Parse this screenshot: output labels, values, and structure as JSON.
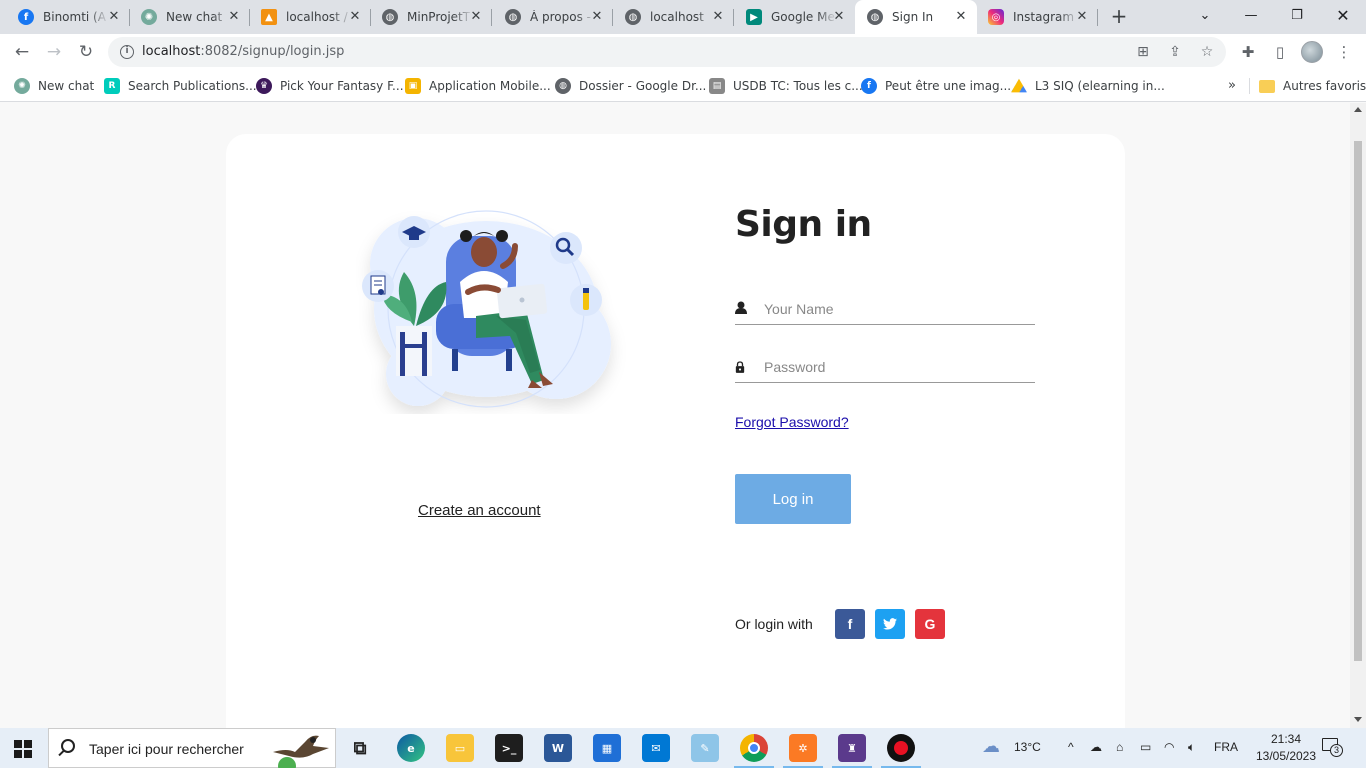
{
  "browser": {
    "tabs": [
      {
        "title": "Binomti (A",
        "favicon": "facebook-icon",
        "color": "#1877f2",
        "active": false
      },
      {
        "title": "New chat",
        "favicon": "chatgpt-icon",
        "color": "#74aa9c",
        "active": false
      },
      {
        "title": "localhost /",
        "favicon": "phpmyadmin-icon",
        "color": "#f29111",
        "active": false
      },
      {
        "title": "MinProjetT",
        "favicon": "globe-icon",
        "color": "#5f6368",
        "active": false
      },
      {
        "title": "À propos -",
        "favicon": "globe-icon",
        "color": "#5f6368",
        "active": false
      },
      {
        "title": "localhost",
        "favicon": "globe-icon",
        "color": "#5f6368",
        "active": false
      },
      {
        "title": "Google Me",
        "favicon": "google-meet-icon",
        "color": "#00897b",
        "active": false
      },
      {
        "title": "Sign In",
        "favicon": "globe-icon",
        "color": "#5f6368",
        "active": true
      },
      {
        "title": "Instagram",
        "favicon": "instagram-icon",
        "color": "#e1306c",
        "active": false
      }
    ],
    "url_host": "localhost",
    "url_rest": ":8082/signup/login.jsp",
    "bookmarks": [
      {
        "label": "New chat",
        "icon": "chatgpt-icon",
        "color": "#74aa9c"
      },
      {
        "label": "Search Publications...",
        "icon": "researchgate-icon",
        "color": "#00ccbb"
      },
      {
        "label": "Pick Your Fantasy F...",
        "icon": "premier-league-icon",
        "color": "#3d195b"
      },
      {
        "label": "Application Mobile...",
        "icon": "classroom-icon",
        "color": "#f4b400"
      },
      {
        "label": "Dossier - Google Dr...",
        "icon": "globe-icon",
        "color": "#5f6368"
      },
      {
        "label": "USDB TC: Tous les c...",
        "icon": "moodle-icon",
        "color": "#888888"
      },
      {
        "label": "Peut être une imag...",
        "icon": "facebook-icon",
        "color": "#1877f2"
      },
      {
        "label": "L3 SIQ (elearning in...",
        "icon": "google-drive-icon",
        "color": "#fbbc04"
      }
    ],
    "bookmarks_more": "»",
    "other_bookmarks": "Autres favoris"
  },
  "page": {
    "title": "Sign in",
    "name_placeholder": "Your Name",
    "password_placeholder": "Password",
    "forgot_password": "Forgot Password?",
    "login_button": "Log in",
    "create_account": "Create an account",
    "or_login_with": "Or login with",
    "social": [
      {
        "label": "f",
        "icon": "facebook-icon",
        "color": "#3b5998"
      },
      {
        "label": "t",
        "icon": "twitter-icon",
        "color": "#1da1f2"
      },
      {
        "label": "G",
        "icon": "google-icon",
        "color": "#e4343c"
      }
    ],
    "button_color": "#6dabe4"
  },
  "taskbar": {
    "search_placeholder": "Taper ici pour rechercher",
    "weather": "13°C",
    "language": "FRA",
    "time": "21:34",
    "date": "13/05/2023",
    "notifications": "3"
  }
}
